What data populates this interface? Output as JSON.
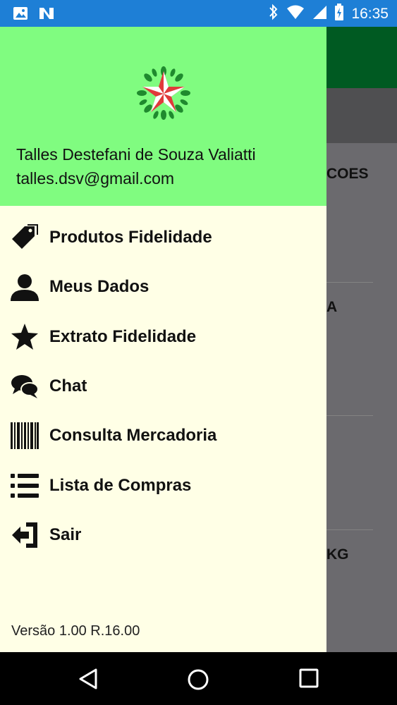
{
  "status_bar": {
    "time": "16:35",
    "left_icons": [
      "image-icon",
      "notification-n-icon"
    ],
    "right_icons": [
      "bluetooth-icon",
      "wifi-icon",
      "signal-icon",
      "battery-icon"
    ]
  },
  "background": {
    "fragments": [
      "COES",
      "A",
      "KG"
    ]
  },
  "drawer": {
    "header": {
      "user_name": "Talles Destefani de Souza Valiatti",
      "user_email": "talles.dsv@gmail.com",
      "header_color": "#80fc80"
    },
    "items": [
      {
        "label": "Produtos Fidelidade",
        "icon": "tags-icon"
      },
      {
        "label": "Meus Dados",
        "icon": "user-icon"
      },
      {
        "label": "Extrato Fidelidade",
        "icon": "star-icon"
      },
      {
        "label": "Chat",
        "icon": "chat-icon"
      },
      {
        "label": "Consulta Mercadoria",
        "icon": "barcode-icon"
      },
      {
        "label": "Lista de Compras",
        "icon": "list-icon"
      },
      {
        "label": "Sair",
        "icon": "sign-out-icon"
      }
    ],
    "version": "Versão 1.00 R.16.00"
  },
  "nav_bar": {
    "buttons": [
      "back-icon",
      "home-icon",
      "recents-icon"
    ]
  }
}
